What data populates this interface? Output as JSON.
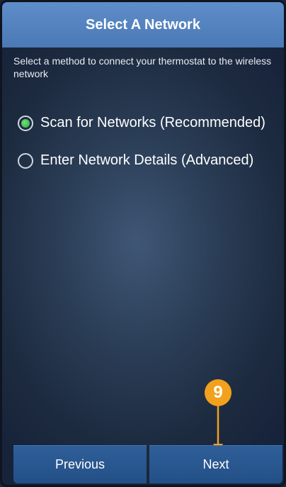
{
  "header": {
    "title": "Select A Network"
  },
  "instructions": "Select a method to connect your thermostat to the wireless network",
  "options": [
    {
      "label": "Scan for Networks (Recommended)",
      "selected": true
    },
    {
      "label": "Enter Network Details (Advanced)",
      "selected": false
    }
  ],
  "step_marker": {
    "number": "9",
    "color": "#f2a11c"
  },
  "buttons": {
    "previous": "Previous",
    "next": "Next"
  },
  "colors": {
    "header": "#5685c1",
    "button": "#2a5890",
    "selected_radio": "#3dbb4a"
  }
}
